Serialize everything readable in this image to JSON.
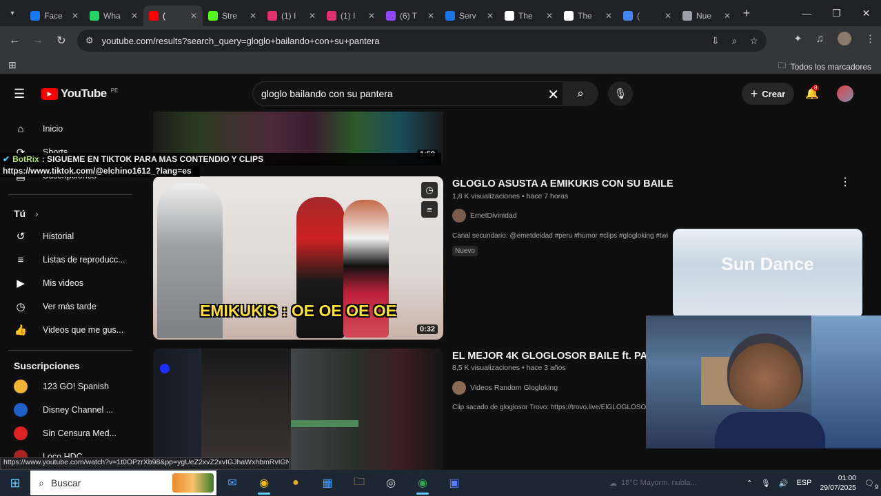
{
  "tabs": [
    {
      "label": "Face",
      "color": "#1877f2"
    },
    {
      "label": "Wha",
      "color": "#25d366"
    },
    {
      "label": "(",
      "color": "#ff0000",
      "active": true
    },
    {
      "label": "Stre",
      "color": "#53fc18"
    },
    {
      "label": "(1) I",
      "color": "#e1306c"
    },
    {
      "label": "(1) I",
      "color": "#e1306c"
    },
    {
      "label": "(6) T",
      "color": "#9146ff"
    },
    {
      "label": "Serv",
      "color": "#1a73e8"
    },
    {
      "label": "The",
      "color": "#ffffff"
    },
    {
      "label": "The",
      "color": "#ffffff"
    },
    {
      "label": "(",
      "color": "#4285f4"
    },
    {
      "label": "Nue",
      "color": "#9aa0a6"
    }
  ],
  "toolbar": {
    "url": "youtube.com/results?search_query=gloglo+bailando+con+su+pantera"
  },
  "bookmarks": {
    "all_label": "Todos los marcadores"
  },
  "youtube": {
    "logo_text": "YouTube",
    "region": "PE",
    "search_value": "gloglo bailando con su pantera",
    "create_label": "Crear",
    "notif_count": "8"
  },
  "sidebar": {
    "items": [
      {
        "label": "Inicio",
        "icon": "⌂"
      },
      {
        "label": "Shorts",
        "icon": "⟳"
      },
      {
        "label": "Suscripciones",
        "icon": "▤"
      }
    ],
    "you_label": "Tú",
    "you_items": [
      {
        "label": "Historial",
        "icon": "↺"
      },
      {
        "label": "Listas de reproducc...",
        "icon": "≡"
      },
      {
        "label": "Mis videos",
        "icon": "▶"
      },
      {
        "label": "Ver más tarde",
        "icon": "◷"
      },
      {
        "label": "Videos que me gus...",
        "icon": "👍"
      }
    ],
    "subs_label": "Suscripciones",
    "subs": [
      {
        "label": "123 GO! Spanish",
        "color": "#f2b233"
      },
      {
        "label": "Disney Channel ...",
        "color": "#1e5fc8"
      },
      {
        "label": "Sin Censura Med...",
        "color": "#d22"
      },
      {
        "label": "Loco HDC",
        "color": "#a22"
      }
    ]
  },
  "chat": {
    "user": "BotRix",
    "message": ": SIGUEME EN TIKTOK PARA MAS CONTENDIO Y CLIPS",
    "link": "https://www.tiktok.com/@elchino1612_?lang=es"
  },
  "videos": [
    {
      "duration": "1:59"
    },
    {
      "title": "GLOGLO ASUSTA A EMIKUKIS CON SU BAILE",
      "meta": "1,8 K visualizaciones • hace 7 horas",
      "channel": "EmetDivinidad",
      "desc": "Canal secundario: @emetdeidad #peru #humor #clips #glogloking #twi",
      "badge": "Nuevo",
      "duration": "0:32",
      "caption": "EMIKUKIS : OE OE OE OE"
    },
    {
      "title": "EL MEJOR 4K GLOGLOSOR BAILE ft. PANT",
      "meta": "8,5 K visualizaciones • hace 3 años",
      "channel": "Videos Random Glogloking",
      "desc": "Clip sacado de gloglosor Trovo: https://trovo.live/ElGLOGLOSO"
    }
  ],
  "preview_text": "Sun Dance",
  "status_url": "https://www.youtube.com/watch?v=1t0OPzrXb98&pp=ygUeZ2xvZ2xvIGJhaWxhbmRvIGNvbiBzdSBwYW50ZXJh",
  "taskbar": {
    "search_placeholder": "Buscar",
    "weather": "16°C  Mayorm. nubla...",
    "lang": "ESP",
    "time": "01:00",
    "date": "29/07/2025",
    "notif": "9"
  }
}
